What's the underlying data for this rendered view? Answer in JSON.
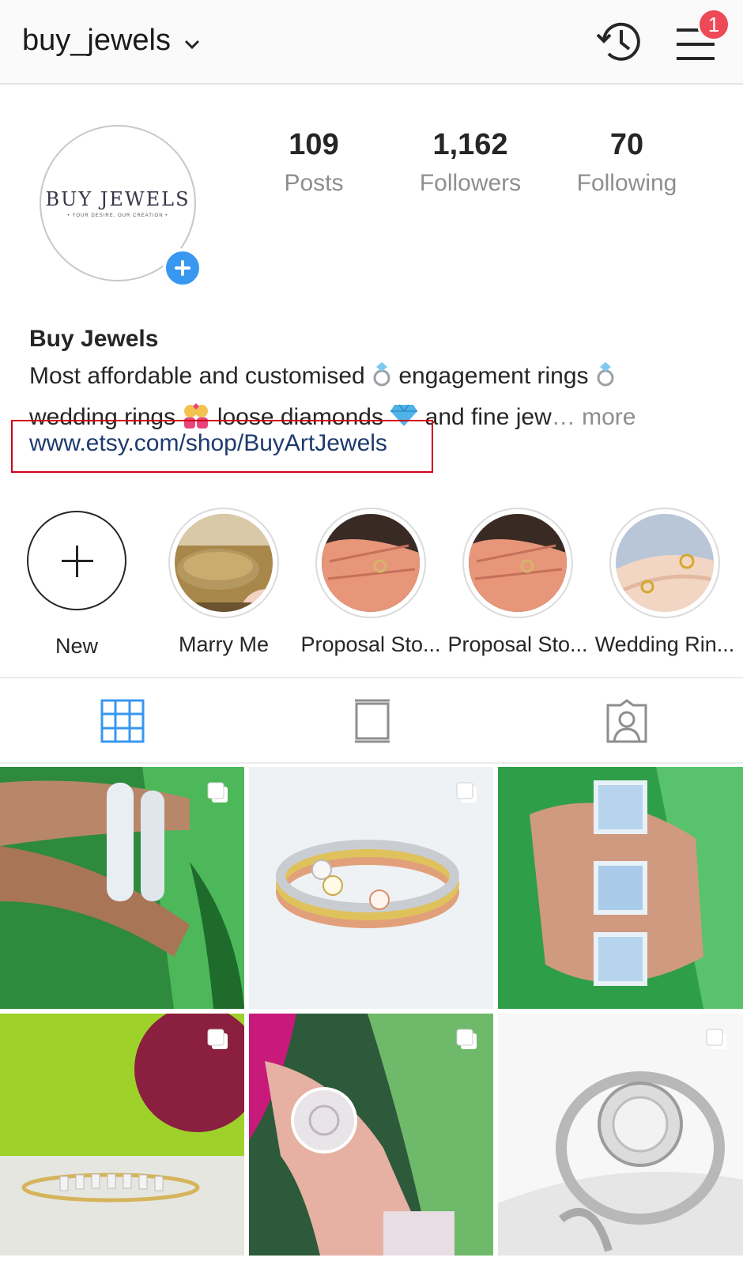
{
  "header": {
    "username": "buy_jewels",
    "notification_count": "1"
  },
  "profile": {
    "avatar_logo": "BUY JEWELS",
    "avatar_tagline": "• YOUR DESIRE, OUR CREATION •",
    "stats": [
      {
        "value": "109",
        "label": "Posts"
      },
      {
        "value": "1,162",
        "label": "Followers"
      },
      {
        "value": "70",
        "label": "Following"
      }
    ]
  },
  "bio": {
    "name": "Buy Jewels",
    "line1_a": "Most affordable and customised",
    "line1_b": "engagement rings",
    "line2_a": "wedding rings",
    "line2_b": "loose diamonds",
    "line2_c": "and fine jew",
    "more": "… more",
    "link": "www.etsy.com/shop/BuyArtJewels"
  },
  "highlights": [
    {
      "label": "New"
    },
    {
      "label": "Marry Me"
    },
    {
      "label": "Proposal Sto..."
    },
    {
      "label": "Proposal Sto..."
    },
    {
      "label": "Wedding Rin..."
    }
  ],
  "tabs": [
    "grid-icon",
    "feed-icon",
    "tagged-icon"
  ],
  "colors": {
    "accent_blue": "#3897f0",
    "badge_red": "#ed4956",
    "highlight_box": "#d0021b",
    "link_color": "#1e3a6e"
  }
}
